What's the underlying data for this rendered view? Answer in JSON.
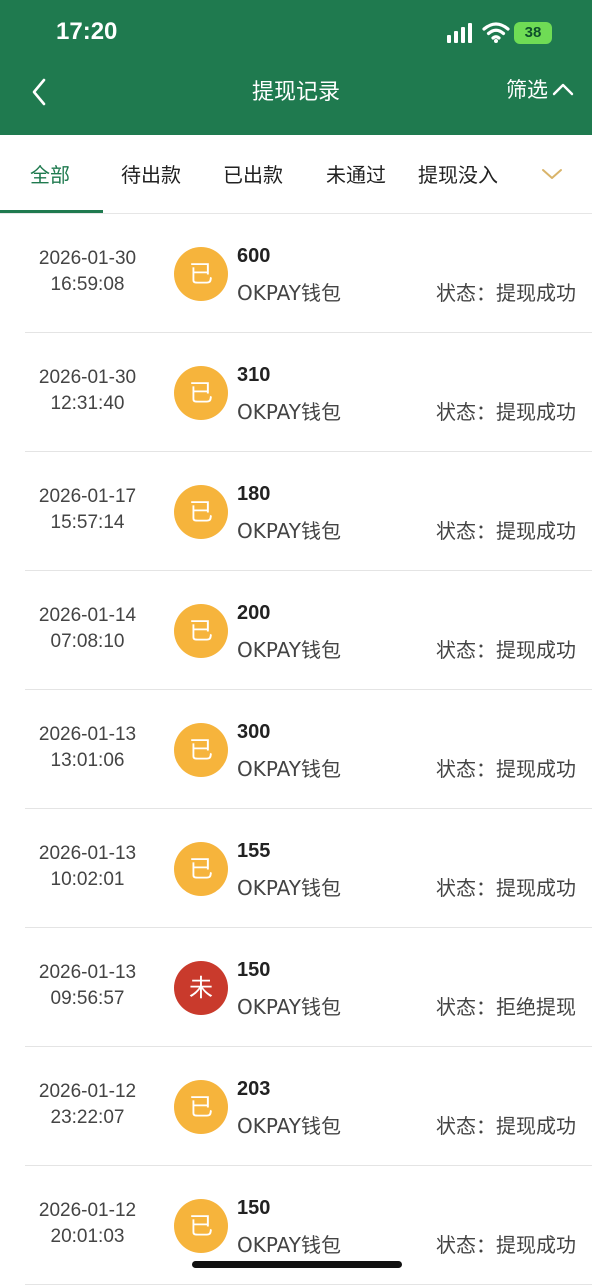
{
  "status_bar": {
    "time": "17:20",
    "battery": "38"
  },
  "nav": {
    "title": "提现记录",
    "filter_label": "筛选"
  },
  "tabs": [
    {
      "label": "全部",
      "active": true
    },
    {
      "label": "待出款"
    },
    {
      "label": "已出款"
    },
    {
      "label": "未通过"
    },
    {
      "label": "提现没入"
    }
  ],
  "status_prefix": "状态：",
  "records": [
    {
      "date": "2026-01-30",
      "time": "16:59:08",
      "badge": "已",
      "badge_type": "ok",
      "amount": "600",
      "wallet": "OKPAY钱包",
      "status": "状态：提现成功"
    },
    {
      "date": "2026-01-30",
      "time": "12:31:40",
      "badge": "已",
      "badge_type": "ok",
      "amount": "310",
      "wallet": "OKPAY钱包",
      "status": "状态：提现成功"
    },
    {
      "date": "2026-01-17",
      "time": "15:57:14",
      "badge": "已",
      "badge_type": "ok",
      "amount": "180",
      "wallet": "OKPAY钱包",
      "status": "状态：提现成功"
    },
    {
      "date": "2026-01-14",
      "time": "07:08:10",
      "badge": "已",
      "badge_type": "ok",
      "amount": "200",
      "wallet": "OKPAY钱包",
      "status": "状态：提现成功"
    },
    {
      "date": "2026-01-13",
      "time": "13:01:06",
      "badge": "已",
      "badge_type": "ok",
      "amount": "300",
      "wallet": "OKPAY钱包",
      "status": "状态：提现成功"
    },
    {
      "date": "2026-01-13",
      "time": "10:02:01",
      "badge": "已",
      "badge_type": "ok",
      "amount": "155",
      "wallet": "OKPAY钱包",
      "status": "状态：提现成功"
    },
    {
      "date": "2026-01-13",
      "time": "09:56:57",
      "badge": "未",
      "badge_type": "no",
      "amount": "150",
      "wallet": "OKPAY钱包",
      "status": "状态：拒绝提现"
    },
    {
      "date": "2026-01-12",
      "time": "23:22:07",
      "badge": "已",
      "badge_type": "ok",
      "amount": "203",
      "wallet": "OKPAY钱包",
      "status": "状态：提现成功"
    },
    {
      "date": "2026-01-12",
      "time": "20:01:03",
      "badge": "已",
      "badge_type": "ok",
      "amount": "150",
      "wallet": "OKPAY钱包",
      "status": "状态：提现成功"
    }
  ],
  "colors": {
    "header": "#1f7a4f",
    "badge_ok": "#f6b43c",
    "badge_no": "#c93a2c"
  }
}
